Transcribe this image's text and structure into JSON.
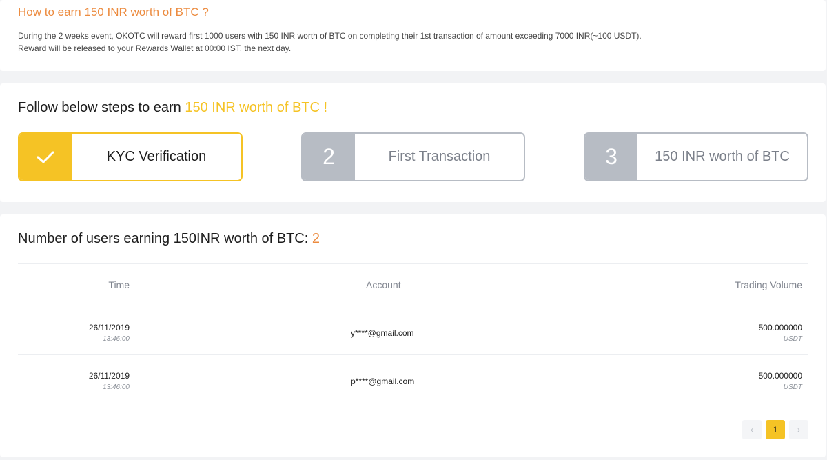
{
  "intro": {
    "title": "How to earn 150 INR worth of BTC ?",
    "line1": "During the 2 weeks event, OKOTC will reward first 1000 users with 150 INR worth of BTC on completing their 1st transaction of amount exceeding 7000 INR(~100 USDT).",
    "line2": "Reward will be released to your Rewards Wallet at 00:00 IST, the next day."
  },
  "steps": {
    "title_prefix": "Follow below steps to earn ",
    "title_highlight": "150 INR worth of BTC !",
    "items": [
      {
        "marker": "✓",
        "label": "KYC Verification",
        "active": true
      },
      {
        "marker": "2",
        "label": "First Transaction",
        "active": false
      },
      {
        "marker": "3",
        "label": "150 INR worth of BTC",
        "active": false
      }
    ]
  },
  "users": {
    "title_prefix": "Number of users earning 150INR worth of BTC: ",
    "count": "2",
    "columns": [
      "Time",
      "Account",
      "Trading Volume"
    ],
    "rows": [
      {
        "date": "26/11/2019",
        "time": "13:46:00",
        "account": "y****@gmail.com",
        "volume": "500.000000",
        "unit": "USDT"
      },
      {
        "date": "26/11/2019",
        "time": "13:46:00",
        "account": "p****@gmail.com",
        "volume": "500.000000",
        "unit": "USDT"
      }
    ]
  },
  "pagination": {
    "prev": "‹",
    "current": "1",
    "next": "›"
  },
  "colors": {
    "accent_yellow": "#f5c325",
    "accent_orange": "#ec8b3f",
    "inactive_gray": "#b7bcc4"
  }
}
